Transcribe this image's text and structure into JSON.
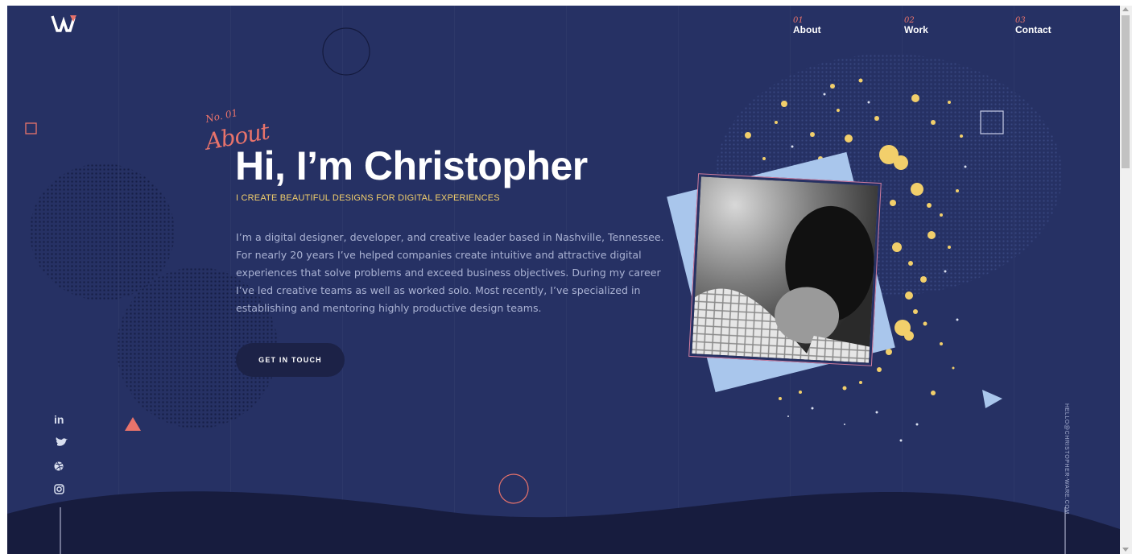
{
  "nav": {
    "logo": "W",
    "items": [
      {
        "num": "01",
        "label": "About"
      },
      {
        "num": "02",
        "label": "Work"
      },
      {
        "num": "03",
        "label": "Contact"
      }
    ]
  },
  "hero": {
    "section_number": "No. 01",
    "section_label": "About",
    "title": "Hi, I’m Christopher",
    "subtitle": "I CREATE BEAUTIFUL DESIGNS FOR DIGITAL EXPERIENCES",
    "bio": "I’m a digital designer, developer, and creative leader based in Nashville, Tennessee. For nearly 20 years I’ve helped companies create intuitive and attractive digital experiences that solve problems and exceed business objectives. During my career I’ve led creative teams as well as worked solo. Most recently, I’ve specialized in establishing and mentoring highly productive design teams.",
    "cta_label": "GET IN TOUCH"
  },
  "social": {
    "icons": [
      "linkedin-icon",
      "twitter-icon",
      "dribbble-icon",
      "instagram-icon"
    ],
    "linkedin_text": "in"
  },
  "contact": {
    "email": "HELLO@CHRISTOPHER-WARE.COM"
  },
  "colors": {
    "background": "#263164",
    "accent_coral": "#e8736b",
    "accent_yellow": "#f2cf6b",
    "accent_blue": "#a9c6ec",
    "dark_wave": "#171c3e"
  }
}
